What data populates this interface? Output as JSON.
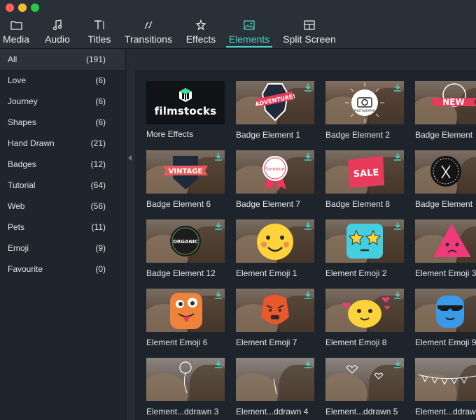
{
  "window": {
    "controls": [
      "close",
      "minimize",
      "zoom"
    ]
  },
  "toolbar": {
    "tabs": [
      {
        "label": "Media",
        "icon": "folder-icon"
      },
      {
        "label": "Audio",
        "icon": "music-note-icon"
      },
      {
        "label": "Titles",
        "icon": "text-icon"
      },
      {
        "label": "Transitions",
        "icon": "transition-icon"
      },
      {
        "label": "Effects",
        "icon": "effects-icon"
      },
      {
        "label": "Elements",
        "icon": "image-icon",
        "active": true
      },
      {
        "label": "Split Screen",
        "icon": "split-screen-icon"
      }
    ],
    "active_color": "#47d3c3"
  },
  "sidebar": {
    "categories": [
      {
        "name": "All",
        "count": "(191)",
        "selected": true
      },
      {
        "name": "Love",
        "count": "(6)"
      },
      {
        "name": "Journey",
        "count": "(6)"
      },
      {
        "name": "Shapes",
        "count": "(6)"
      },
      {
        "name": "Hand Drawn",
        "count": "(21)"
      },
      {
        "name": "Badges",
        "count": "(12)"
      },
      {
        "name": "Tutorial",
        "count": "(64)"
      },
      {
        "name": "Web",
        "count": "(56)"
      },
      {
        "name": "Pets",
        "count": "(11)"
      },
      {
        "name": "Emoji",
        "count": "(9)"
      },
      {
        "name": "Favourite",
        "count": "(0)"
      }
    ]
  },
  "grid": {
    "items": [
      {
        "label": "More Effects",
        "kind": "filmstocks",
        "logo_text": "filmstocks"
      },
      {
        "label": "Badge Element 1",
        "kind": "badge",
        "badge_text": "ADVENTURE!"
      },
      {
        "label": "Badge Element 2",
        "kind": "badge",
        "badge_text": "PHOTOGRAPHY"
      },
      {
        "label": "Badge Element",
        "kind": "badge",
        "badge_text": "NEW"
      },
      {
        "label": "Badge Element 6",
        "kind": "badge",
        "badge_text": "VINTAGE"
      },
      {
        "label": "Badge Element 7",
        "kind": "badge",
        "badge_text": "Premium"
      },
      {
        "label": "Badge Element 8",
        "kind": "badge",
        "badge_text": "SALE"
      },
      {
        "label": "Badge Element",
        "kind": "badge",
        "badge_text": ""
      },
      {
        "label": "Badge Element 12",
        "kind": "badge",
        "badge_text": "ORGANIC"
      },
      {
        "label": "Element Emoji 1",
        "kind": "emoji"
      },
      {
        "label": "Element Emoji 2",
        "kind": "emoji"
      },
      {
        "label": "Element Emoji 3",
        "kind": "emoji"
      },
      {
        "label": "Element Emoji 6",
        "kind": "emoji"
      },
      {
        "label": "Element Emoji 7",
        "kind": "emoji"
      },
      {
        "label": "Element Emoji 8",
        "kind": "emoji"
      },
      {
        "label": "Element Emoji 9",
        "kind": "emoji"
      },
      {
        "label": "Element...ddrawn 3",
        "kind": "handdrawn"
      },
      {
        "label": "Element...ddrawn 4",
        "kind": "handdrawn"
      },
      {
        "label": "Element...ddrawn 5",
        "kind": "handdrawn"
      },
      {
        "label": "Element...ddrawn",
        "kind": "handdrawn"
      }
    ]
  }
}
